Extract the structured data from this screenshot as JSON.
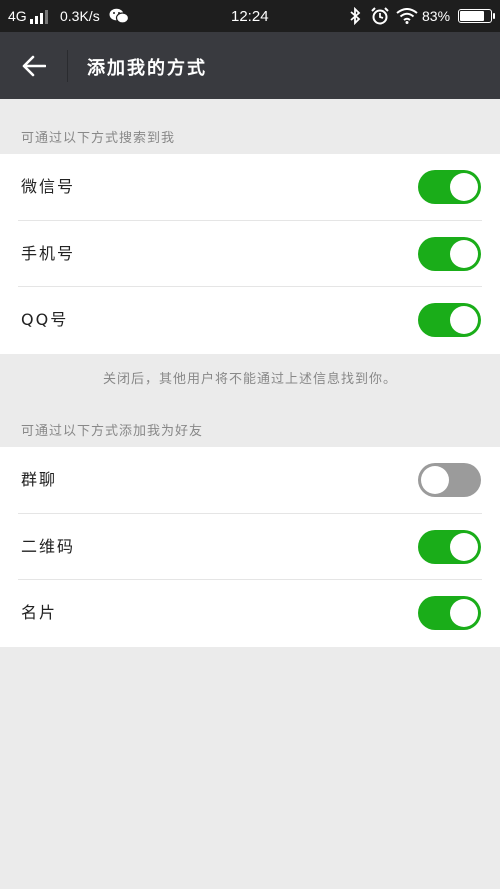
{
  "status_bar": {
    "network": "4G",
    "speed": "0.3K/s",
    "time": "12:24",
    "battery_percent": "83%",
    "battery_level": 0.83
  },
  "title_bar": {
    "title": "添加我的方式"
  },
  "search_section": {
    "header": "可通过以下方式搜索到我",
    "items": [
      {
        "label": "微信号",
        "enabled": true
      },
      {
        "label": "手机号",
        "enabled": true
      },
      {
        "label": "QQ号",
        "enabled": true
      }
    ],
    "note": "关闭后，其他用户将不能通过上述信息找到你。"
  },
  "add_section": {
    "header": "可通过以下方式添加我为好友",
    "items": [
      {
        "label": "群聊",
        "enabled": false
      },
      {
        "label": "二维码",
        "enabled": true
      },
      {
        "label": "名片",
        "enabled": true
      }
    ]
  },
  "colors": {
    "toggle_on": "#1aad19",
    "toggle_off": "#9b9b9b",
    "title_bar_bg": "#393a3f",
    "status_bar_bg": "#1e1e1e",
    "page_bg": "#ebebeb"
  }
}
